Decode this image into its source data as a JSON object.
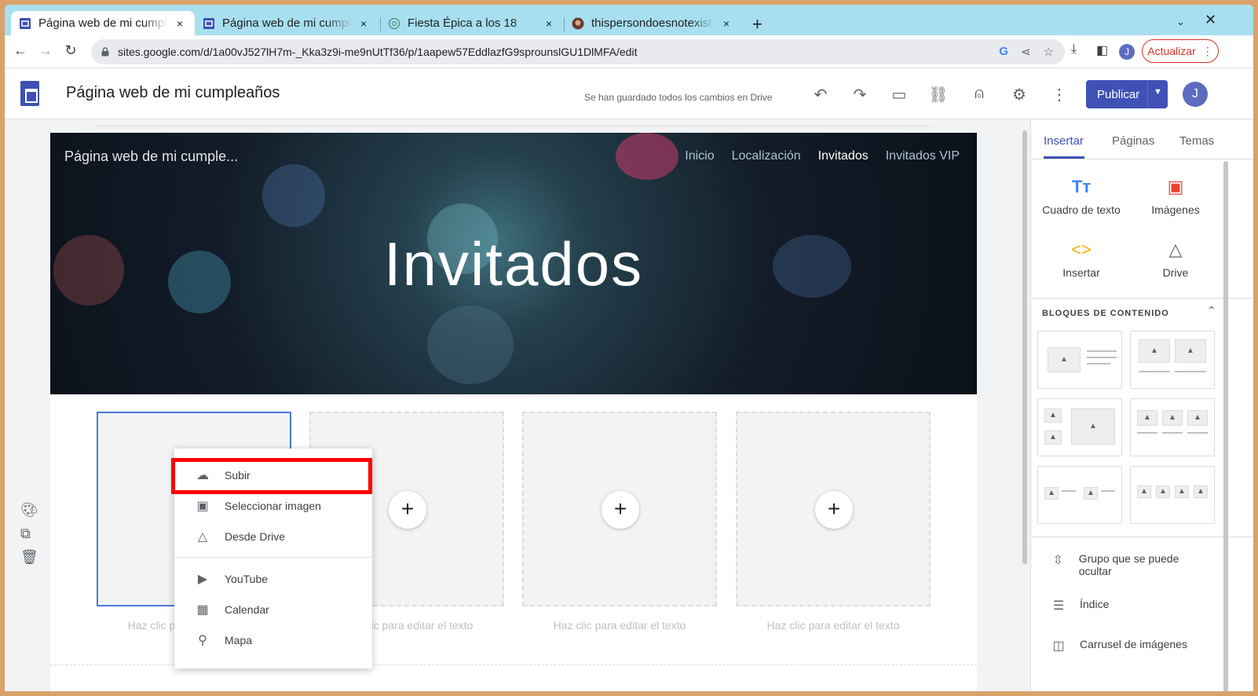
{
  "browser": {
    "tabs": [
      {
        "title": "Página web de mi cumpleaños",
        "close": "×"
      },
      {
        "title": "Página web de mi cumpleaños",
        "close": "×"
      },
      {
        "title": "Fiesta Épica a los 18",
        "close": "×"
      },
      {
        "title": "thispersondoesnotexist.com",
        "close": "×"
      }
    ],
    "new_tab": "+",
    "url": "sites.google.com/d/1a00vJ527lH7m-_Kka3z9i-me9nUtTf36/p/1aapew57EddlazfG9sprounslGU1DlMFA/edit",
    "profile_initial": "J",
    "update_label": "Actualizar"
  },
  "app": {
    "title": "Página web de mi cumpleaños",
    "save_status": "Se han guardado todos los cambios en Drive",
    "publish_label": "Publicar",
    "avatar_initial": "J"
  },
  "site": {
    "name": "Página web de mi cumple...",
    "nav": [
      "Inicio",
      "Localización",
      "Invitados",
      "Invitados VIP"
    ],
    "current_nav": "Invitados",
    "hero_title": "Invitados",
    "placeholders": [
      {
        "caption": "Haz clic para editar el texto"
      },
      {
        "caption": "Haz clic para editar el texto"
      },
      {
        "caption": "Haz clic para editar el texto"
      },
      {
        "caption": "Haz clic para editar el texto"
      }
    ]
  },
  "image_menu": {
    "items": [
      {
        "label": "Subir",
        "icon": "cloud-upload-icon"
      },
      {
        "label": "Seleccionar imagen",
        "icon": "image-icon"
      },
      {
        "label": "Desde Drive",
        "icon": "drive-icon"
      },
      {
        "label": "YouTube",
        "icon": "youtube-icon"
      },
      {
        "label": "Calendar",
        "icon": "calendar-icon"
      },
      {
        "label": "Mapa",
        "icon": "map-pin-icon"
      }
    ],
    "highlighted": "Subir",
    "highlight_color": "#ff0000"
  },
  "panel": {
    "tabs": [
      "Insertar",
      "Páginas",
      "Temas"
    ],
    "active_tab": "Insertar",
    "insert_items": [
      {
        "label": "Cuadro de texto",
        "icon": "text-box-icon",
        "color": "#4285f4"
      },
      {
        "label": "Imágenes",
        "icon": "image-icon",
        "color": "#ea4335"
      },
      {
        "label": "Insertar",
        "icon": "embed-icon",
        "color": "#f4b400"
      },
      {
        "label": "Drive",
        "icon": "drive-icon",
        "color": "#5f6368"
      }
    ],
    "blocks_title": "BLOQUES DE CONTENIDO",
    "list_items": [
      {
        "label": "Grupo que se puede ocultar",
        "icon": "collapsible-group-icon"
      },
      {
        "label": "Índice",
        "icon": "list-icon"
      },
      {
        "label": "Carrusel de imágenes",
        "icon": "carousel-icon"
      }
    ]
  },
  "colors": {
    "accent": "#3f51b5",
    "selection": "#4c79dc",
    "tabstrip": "#a8dff0"
  }
}
